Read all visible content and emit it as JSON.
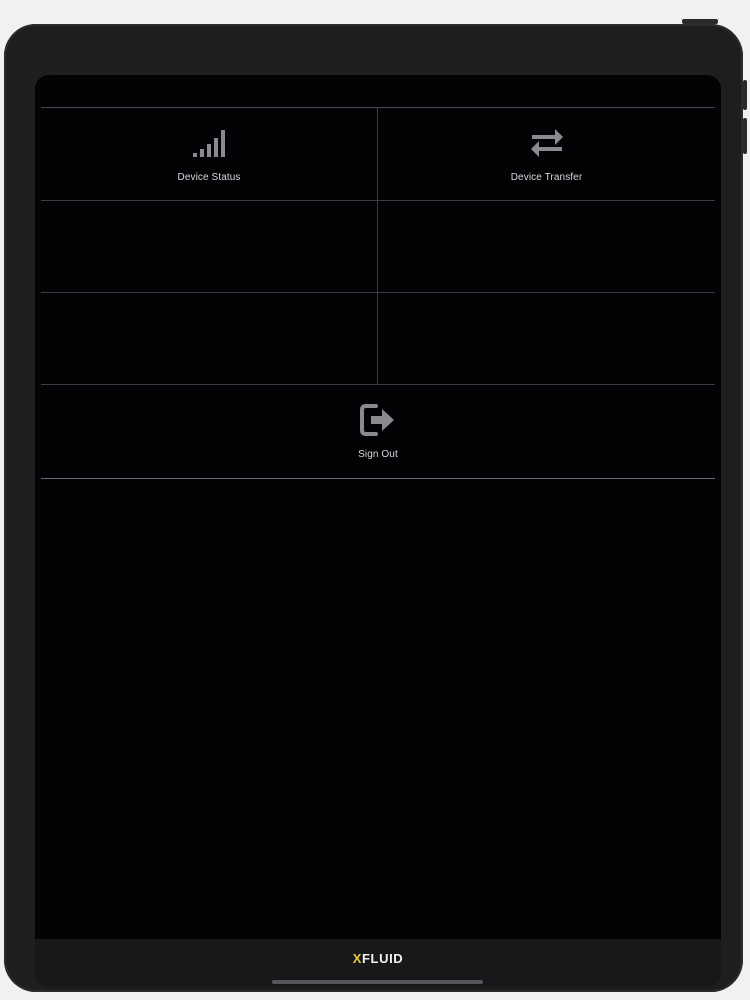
{
  "menu": {
    "items": [
      {
        "label": "Device Status",
        "icon": "signal-bars-icon"
      },
      {
        "label": "Device Transfer",
        "icon": "transfer-arrows-icon"
      }
    ],
    "sign_out": {
      "label": "Sign Out",
      "icon": "sign-out-icon"
    }
  },
  "footer": {
    "brand_accent": "X",
    "brand_rest": "FLUID"
  },
  "colors": {
    "background": "#030305",
    "icon": "#8a8a8e",
    "label": "#d8d8dc",
    "brand_accent": "#e5c93a"
  }
}
